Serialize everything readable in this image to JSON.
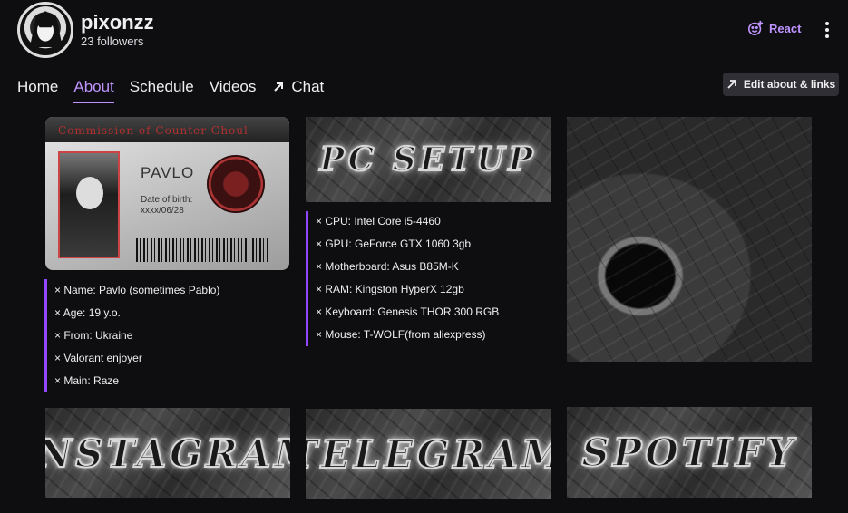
{
  "channel": {
    "name": "pixonzz",
    "followers": "23 followers"
  },
  "header": {
    "react_label": "React"
  },
  "nav": {
    "tabs": [
      {
        "label": "Home"
      },
      {
        "label": "About"
      },
      {
        "label": "Schedule"
      },
      {
        "label": "Videos"
      },
      {
        "label": "Chat"
      }
    ],
    "active_tab": "About"
  },
  "edit_button": {
    "label": "Edit about & links"
  },
  "id_card": {
    "title": "Commission of Counter Ghoul",
    "name": "PAVLO",
    "dob_label": "Date of birth:",
    "dob": "xxxx/06/28"
  },
  "about_list": [
    "Name: Pavlo (sometimes Pablo)",
    "Age: 19 y.o.",
    "From: Ukraine",
    "Valorant enjoyer",
    "Main: Raze"
  ],
  "pc_setup": {
    "banner": "PC SETUP",
    "items": [
      "CPU: Intel Core i5-4460",
      "GPU: GeForce GTX 1060 3gb",
      "Motherboard: Asus B85M-K",
      "RAM: Kingston HyperX 12gb",
      "Keyboard: Genesis THOR 300 RGB",
      "Mouse: T-WOLF(from aliexpress)"
    ]
  },
  "social_banners": {
    "instagram": "INSTAGRAM",
    "telegram": "TELEGRAM",
    "spotify": "SPOTIFY"
  },
  "colors": {
    "accent": "#bf94ff",
    "background": "#0e0e10",
    "panel_line": "#9147ff"
  }
}
